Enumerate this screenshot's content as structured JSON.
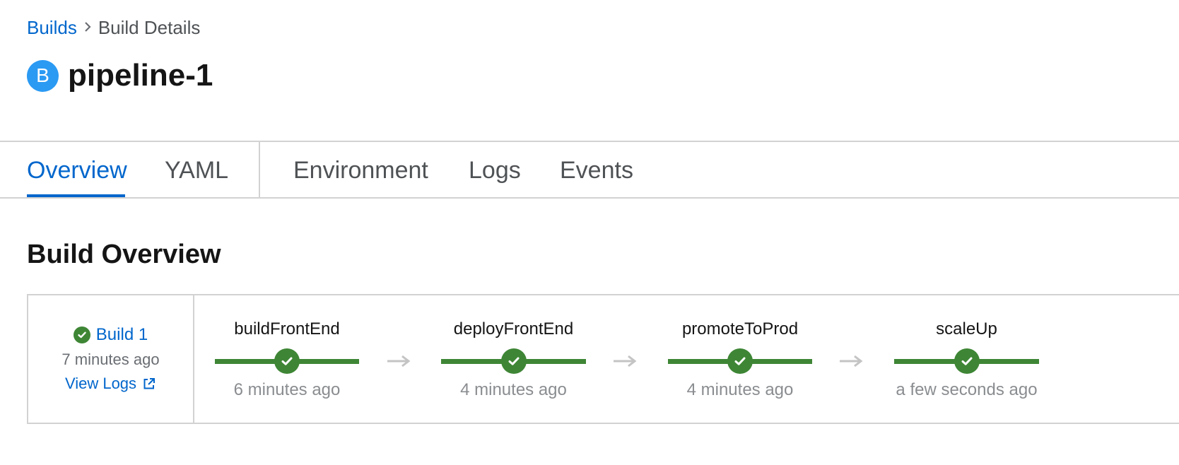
{
  "breadcrumb": {
    "parent": "Builds",
    "current": "Build Details"
  },
  "header": {
    "badge": "B",
    "title": "pipeline-1"
  },
  "tabs": [
    {
      "label": "Overview",
      "active": true
    },
    {
      "label": "YAML",
      "active": false
    },
    {
      "label": "Environment",
      "active": false
    },
    {
      "label": "Logs",
      "active": false
    },
    {
      "label": "Events",
      "active": false
    }
  ],
  "overview": {
    "section_title": "Build Overview",
    "build": {
      "label": "Build 1",
      "status": "success",
      "time": "7 minutes ago",
      "view_logs": "View Logs"
    },
    "stages": [
      {
        "name": "buildFrontEnd",
        "status": "success",
        "time": "6 minutes ago"
      },
      {
        "name": "deployFrontEnd",
        "status": "success",
        "time": "4 minutes ago"
      },
      {
        "name": "promoteToProd",
        "status": "success",
        "time": "4 minutes ago"
      },
      {
        "name": "scaleUp",
        "status": "success",
        "time": "a few seconds ago"
      }
    ]
  },
  "colors": {
    "link": "#0066cc",
    "success": "#3e8635",
    "badge": "#2b9af3",
    "border": "#d2d2d2"
  },
  "icons": [
    "chevron-right-icon",
    "check-circle-icon",
    "external-link-icon",
    "arrow-right-icon"
  ]
}
